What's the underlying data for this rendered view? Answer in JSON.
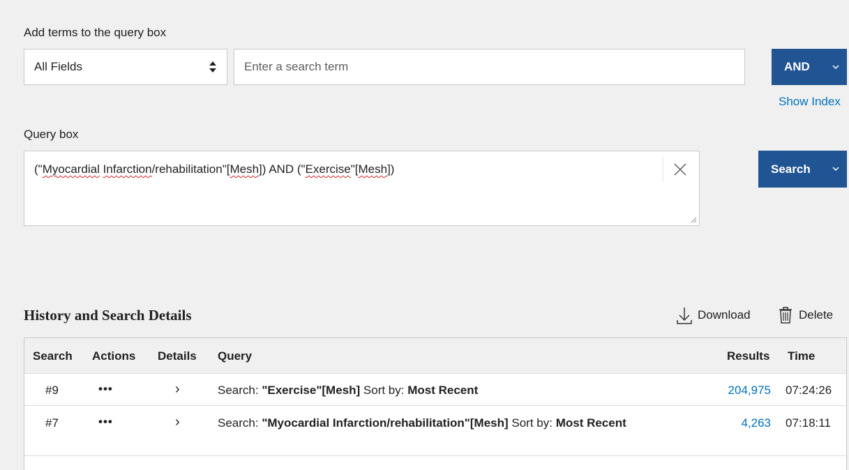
{
  "builder": {
    "add_terms_label": "Add terms to the query box",
    "field_select_value": "All Fields",
    "term_placeholder": "Enter a search term",
    "and_button": "AND",
    "show_index": "Show Index"
  },
  "query": {
    "label": "Query box",
    "open1": "(\"",
    "word1": "Myocardial",
    "space1": " ",
    "word2": "Infarction",
    "mid1": "/rehabilitation\"[",
    "word3": "Mesh",
    "mid2": "]) AND (\"",
    "word4": "Exercise",
    "mid3": "\"[",
    "word5": "Mesh",
    "close": "])",
    "search_button": "Search"
  },
  "history": {
    "title": "History and Search Details",
    "download": "Download",
    "delete": "Delete",
    "columns": [
      "Search",
      "Actions",
      "Details",
      "Query",
      "Results",
      "Time"
    ],
    "rows": [
      {
        "search": "#9",
        "actions": "•••",
        "details": "›",
        "query_prefix": "Search: ",
        "query_term": "\"Exercise\"[Mesh]",
        "query_sort_label": " Sort by: ",
        "query_sort": "Most Recent",
        "results": "204,975",
        "time": "07:24:26"
      },
      {
        "search": "#7",
        "actions": "•••",
        "details": "›",
        "query_prefix": "Search: ",
        "query_term": "\"Myocardial Infarction/rehabilitation\"[Mesh]",
        "query_sort_label": " Sort by: ",
        "query_sort": "Most Recent",
        "results": "4,263",
        "time": "07:18:11"
      }
    ]
  },
  "colors": {
    "primary_blue": "#205493",
    "link_blue": "#0071bc",
    "background": "#f0f0f0"
  }
}
